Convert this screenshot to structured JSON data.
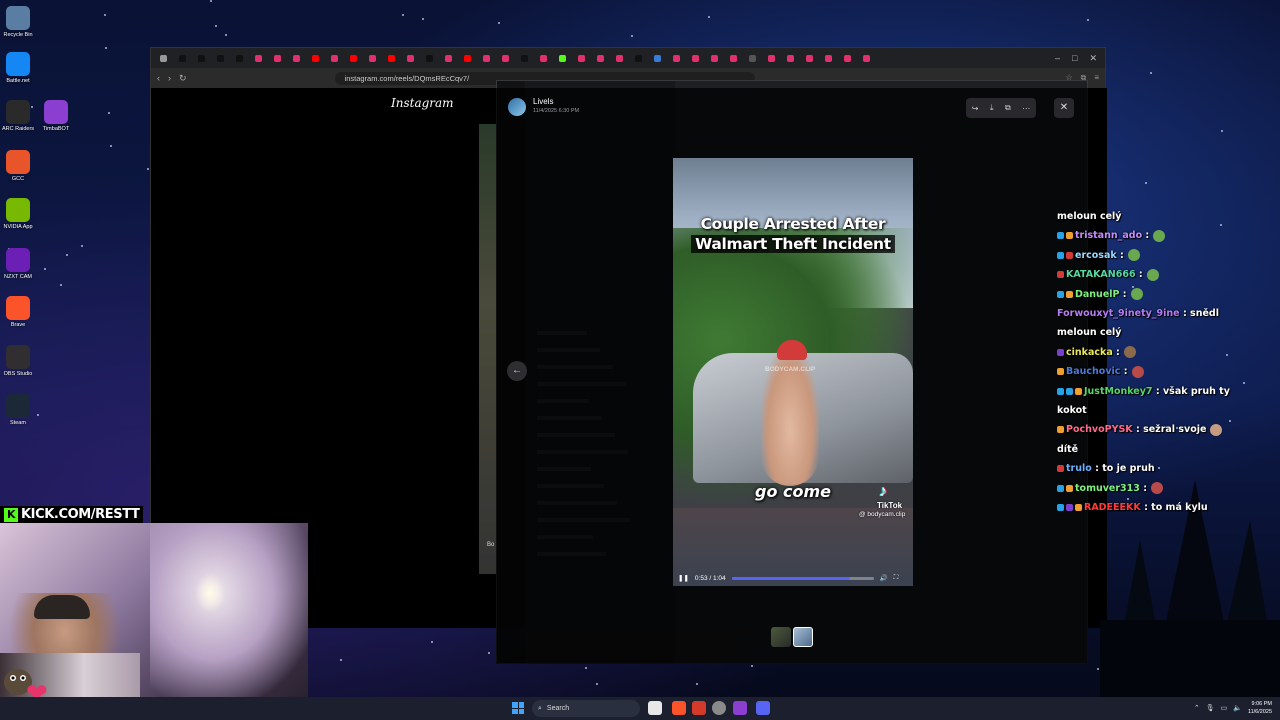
{
  "desktop": {
    "icons": [
      {
        "label": "Recycle Bin",
        "icon": "recycle-bin-icon",
        "color": "#5a7da3"
      },
      {
        "label": "Battle.net",
        "icon": "battlenet-icon",
        "color": "#1587f4"
      },
      {
        "label": "ARC Raiders",
        "icon": "arc-raiders-icon",
        "color": "#2a2a2a"
      },
      {
        "label": "TimbaBOT",
        "icon": "timbabot-icon",
        "color": "#8a3fd1"
      },
      {
        "label": "GCC",
        "icon": "gcc-icon",
        "color": "#e8552a"
      },
      {
        "label": "NVIDIA App",
        "icon": "nvidia-icon",
        "color": "#76b900"
      },
      {
        "label": "NZXT CAM",
        "icon": "nzxt-cam-icon",
        "color": "#6b1fb5"
      },
      {
        "label": "Brave",
        "icon": "brave-icon",
        "color": "#fb542b"
      },
      {
        "label": "OBS Studio",
        "icon": "obs-icon",
        "color": "#302e31"
      },
      {
        "label": "Steam",
        "icon": "steam-icon",
        "color": "#1b2838"
      }
    ]
  },
  "browser": {
    "url": "instagram.com/reels/DQmsREcCqv7/",
    "site_logo": "Instagram",
    "reel_partial_label": "Bo"
  },
  "viewer": {
    "author": "Livels",
    "timestamp": "11/4/2025 6:30 PM",
    "video": {
      "title_line1": "Couple Arrested After",
      "title_line2": "Walmart Theft Incident",
      "watermark": "BODYCAM.CLIP",
      "caption": "go come",
      "tiktok_label": "TikTok",
      "handle": "@ bodycam.clip",
      "time": "0:53 / 1:04",
      "progress": 0.83
    }
  },
  "chat": [
    {
      "user": "",
      "msg": "meloun celý",
      "color": "#ffffff",
      "badges": []
    },
    {
      "user": "tristann_ado",
      "msg": ":",
      "color": "#c58cff",
      "badges": [
        "#29a3e8",
        "#f0a030"
      ],
      "emote": "#6aa84f"
    },
    {
      "user": "ercosak",
      "msg": ":",
      "color": "#9ad9ff",
      "badges": [
        "#29a3e8",
        "#d33a3a"
      ],
      "emote": "#6aa84f"
    },
    {
      "user": "KATAKAN666",
      "msg": ":",
      "color": "#58d6a0",
      "badges": [
        "#d33a3a"
      ],
      "emote": "#6aa84f"
    },
    {
      "user": "DanuelP",
      "msg": ":",
      "color": "#7ef07e",
      "badges": [
        "#29a3e8",
        "#f0a030"
      ],
      "emote": "#6aa84f"
    },
    {
      "user": "Forwouxyt_9inety_9ine",
      "msg": ": snědl",
      "color": "#b57cf2",
      "badges": []
    },
    {
      "user": "",
      "msg": "meloun celý",
      "color": "#ffffff",
      "badges": []
    },
    {
      "user": "cinkacka",
      "msg": ":",
      "color": "#e8e85a",
      "badges": [
        "#7a3fd1"
      ],
      "emote": "#8a6a4a"
    },
    {
      "user": "Bauchovic",
      "msg": ":",
      "color": "#4a7ad8",
      "badges": [
        "#f0a030"
      ],
      "emote": "#b84a4a"
    },
    {
      "user": "JustMonkey7",
      "msg": ": však pruh ty",
      "color": "#58d66a",
      "badges": [
        "#29a3e8",
        "#29a3e8",
        "#f0a030"
      ]
    },
    {
      "user": "",
      "msg": "kokot",
      "color": "#ffffff",
      "badges": []
    },
    {
      "user": "PochvoPYSK",
      "msg": ": sežral svoje",
      "color": "#ff6a8a",
      "badges": [
        "#f0a030"
      ],
      "emote": "#c79b82"
    },
    {
      "user": "",
      "msg": "dítě",
      "color": "#ffffff",
      "badges": []
    },
    {
      "user": "trulo",
      "msg": ": to je pruh",
      "color": "#6ab0ff",
      "badges": [
        "#d33a3a"
      ]
    },
    {
      "user": "tomuver313",
      "msg": ":",
      "color": "#7ef07e",
      "badges": [
        "#29a3e8",
        "#f0a030"
      ],
      "emote": "#b84a4a"
    },
    {
      "user": "RADEEEKK",
      "msg": ": to má kylu",
      "color": "#ff3b3b",
      "badges": [
        "#29a3e8",
        "#7a3fd1",
        "#f0a030"
      ]
    }
  ],
  "stream": {
    "kick_handle": "KICK.COM/RESTT",
    "kick_color": "#53fc18"
  },
  "taskbar": {
    "search_placeholder": "Search",
    "time": "9:06 PM",
    "date": "11/6/2025"
  }
}
